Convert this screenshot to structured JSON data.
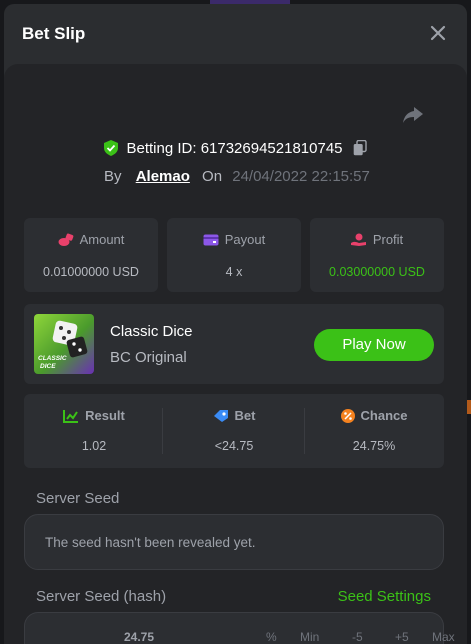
{
  "modal": {
    "title": "Bet Slip",
    "close_icon": "close-icon",
    "share_icon": "share-icon"
  },
  "bet": {
    "id_label": "Betting ID:",
    "id_value": "61732694521810745",
    "by_label": "By",
    "username": "Alemao",
    "on_label": "On",
    "datetime": "24/04/2022 22:15:57"
  },
  "stats": {
    "amount": {
      "label": "Amount",
      "value": "0.01000000 USD",
      "icon": "coin-stack-icon",
      "color": "#e8416b"
    },
    "payout": {
      "label": "Payout",
      "value": "4 x",
      "icon": "wallet-icon",
      "color": "#8c57e8"
    },
    "profit": {
      "label": "Profit",
      "value": "0.03000000 USD",
      "icon": "hand-coin-icon",
      "color": "#e8416b",
      "value_color": "#3bc117"
    }
  },
  "game": {
    "name": "Classic Dice",
    "provider": "BC Original",
    "play_label": "Play Now",
    "thumb_text": "CLASSIC DICE"
  },
  "result": {
    "result": {
      "label": "Result",
      "value": "1.02",
      "icon": "chart-icon",
      "color": "#3bc117"
    },
    "bet": {
      "label": "Bet",
      "value": "<24.75",
      "icon": "tag-icon",
      "color": "#3a8bf5"
    },
    "chance": {
      "label": "Chance",
      "value": "24.75%",
      "icon": "percent-icon",
      "color": "#f5821f"
    }
  },
  "seeds": {
    "server_seed_label": "Server Seed",
    "server_seed_value": "The seed hasn't been revealed yet.",
    "server_hash_label": "Server Seed (hash)",
    "seed_settings_label": "Seed Settings"
  },
  "background": {
    "strip_items": [
      "24.75",
      "%",
      "Min",
      "-5",
      "+5",
      "Max"
    ]
  },
  "colors": {
    "accent_green": "#3bc117",
    "panel": "#2c2e32",
    "modal": "#2b2d30"
  }
}
